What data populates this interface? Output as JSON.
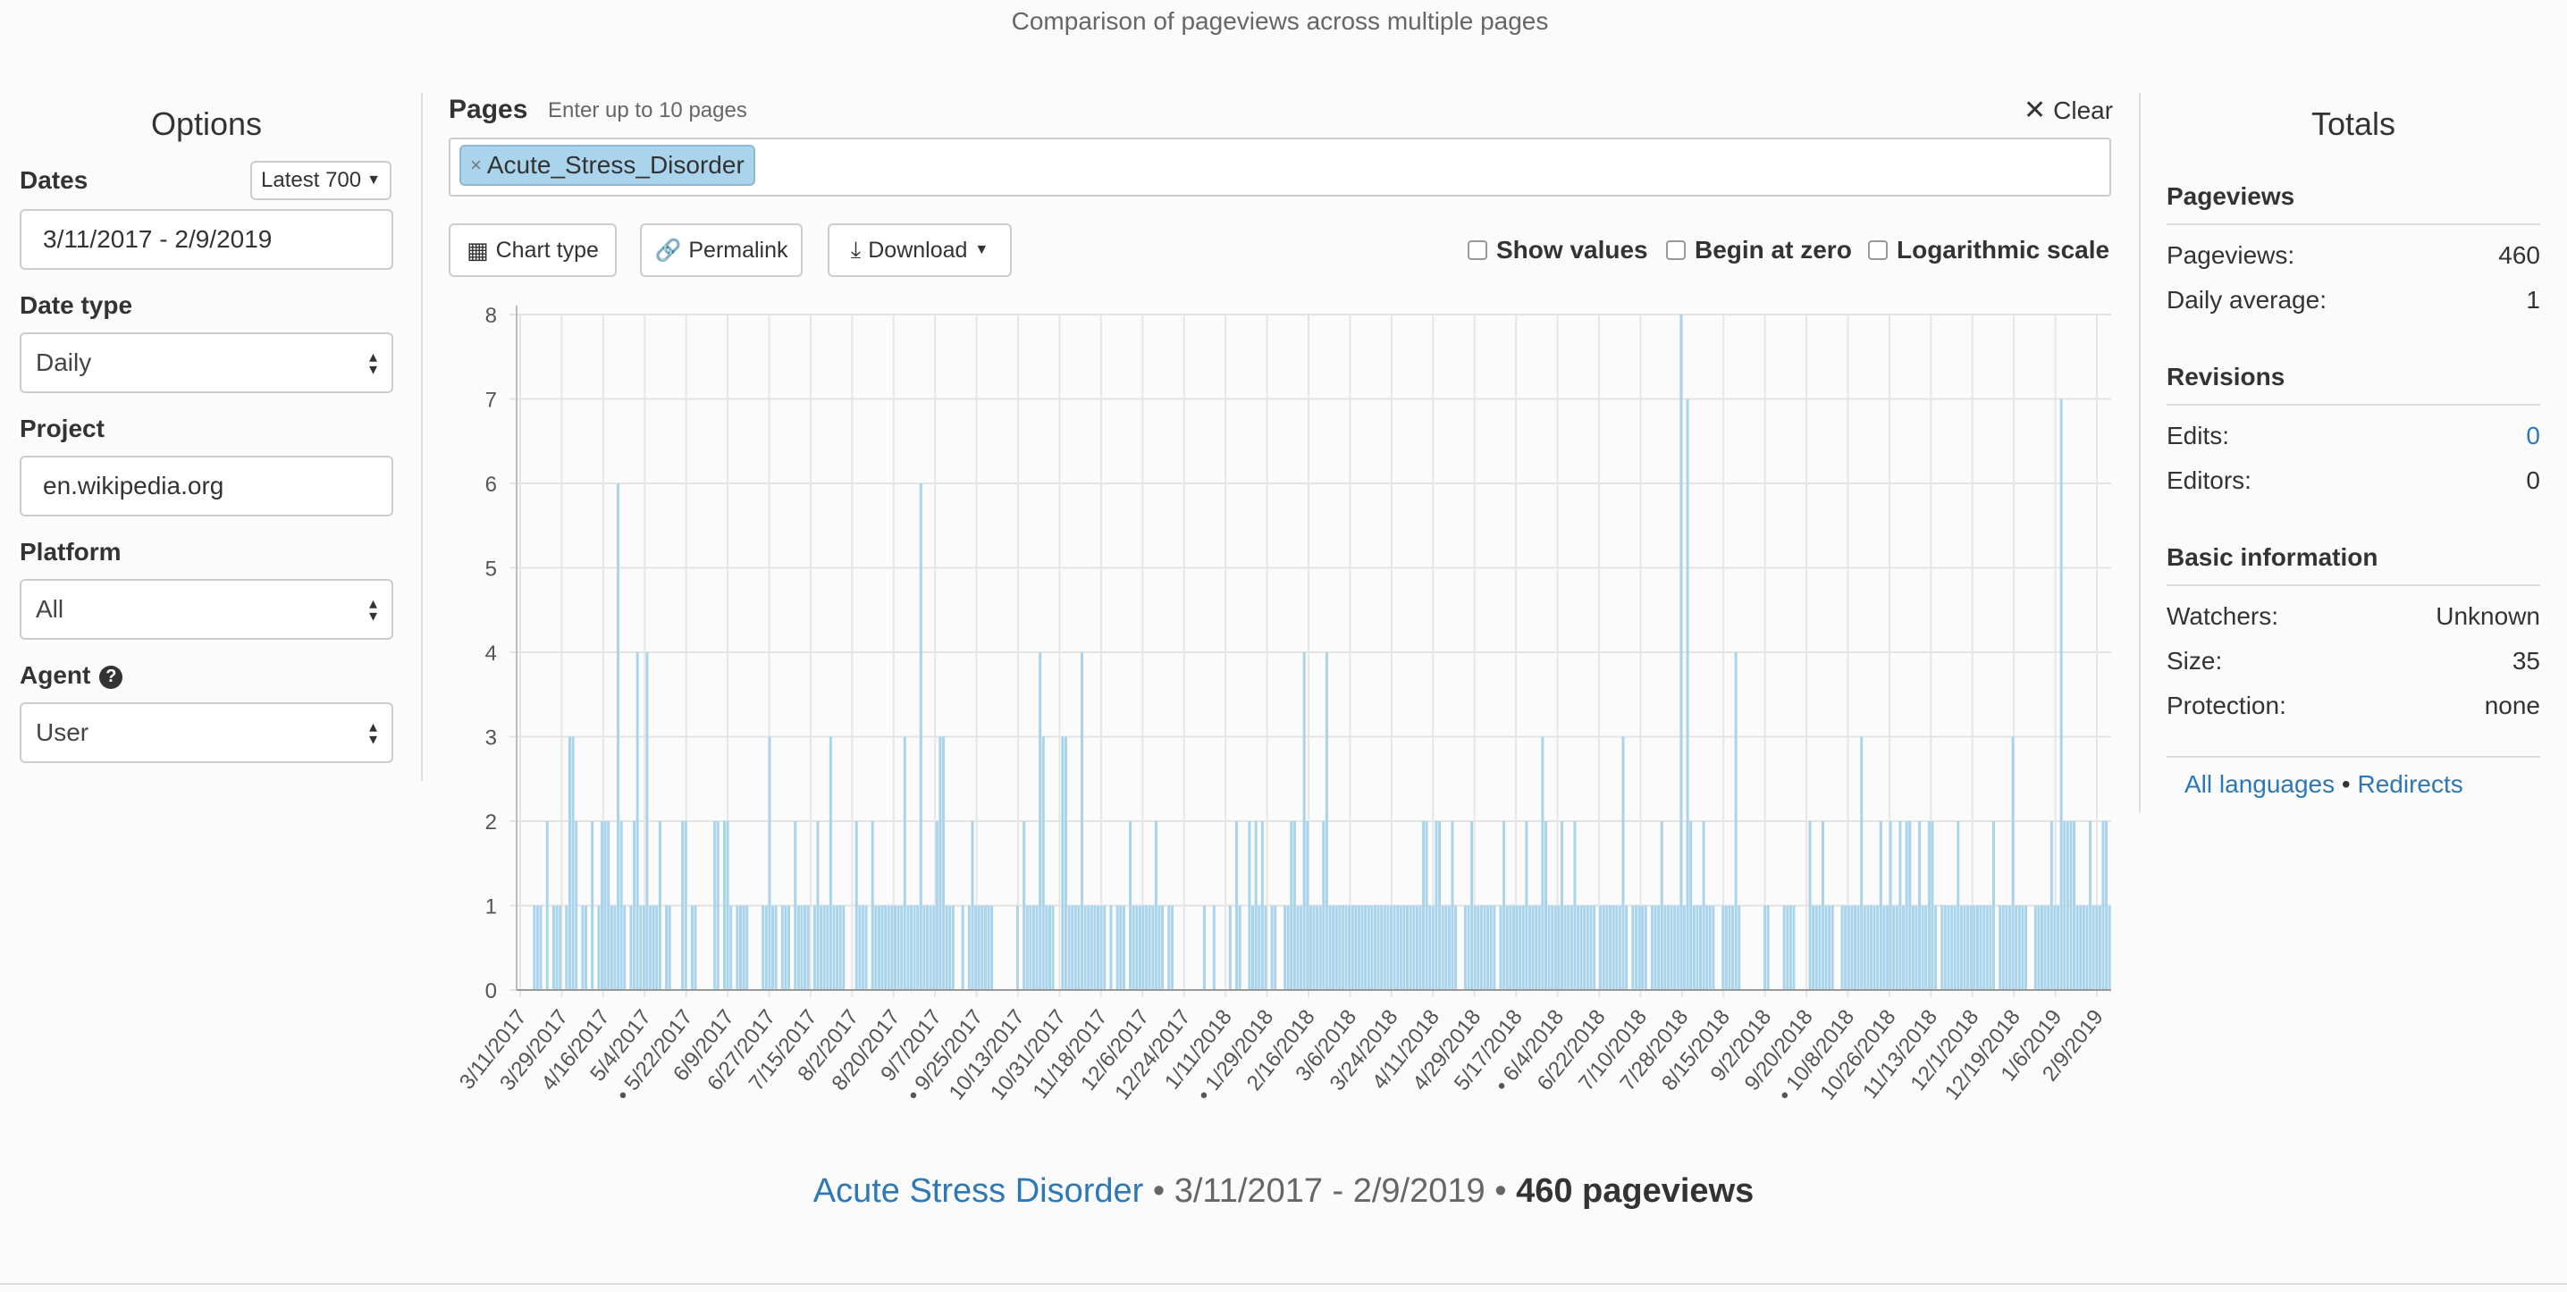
{
  "caption": "Comparison of pageviews across multiple pages",
  "options": {
    "title": "Options",
    "dates_label": "Dates",
    "latest_button": "Latest 700",
    "dates_value": "3/11/2017 - 2/9/2019",
    "date_type_label": "Date type",
    "date_type_value": "Daily",
    "project_label": "Project",
    "project_value": "en.wikipedia.org",
    "platform_label": "Platform",
    "platform_value": "All",
    "agent_label": "Agent",
    "agent_value": "User"
  },
  "pages": {
    "label": "Pages",
    "hint": "Enter up to 10 pages",
    "clear_label": "Clear",
    "tag": "Acute_Stress_Disorder"
  },
  "toolbar": {
    "chart_type": "Chart type",
    "permalink": "Permalink",
    "download": "Download",
    "show_values": "Show values",
    "begin_at_zero": "Begin at zero",
    "log_scale": "Logarithmic scale"
  },
  "chart_data": {
    "type": "bar",
    "title": "",
    "xlabel": "",
    "ylabel": "",
    "ylim": [
      0,
      8
    ],
    "yticks": [
      0,
      1,
      2,
      3,
      4,
      5,
      6,
      7,
      8
    ],
    "xtick_labels": [
      "3/11/2017",
      "3/29/2017",
      "4/16/2017",
      "5/4/2017",
      "• 5/22/2017",
      "6/9/2017",
      "6/27/2017",
      "7/15/2017",
      "8/2/2017",
      "8/20/2017",
      "9/7/2017",
      "• 9/25/2017",
      "10/13/2017",
      "10/31/2017",
      "11/18/2017",
      "12/6/2017",
      "12/24/2017",
      "1/11/2018",
      "• 1/29/2018",
      "2/16/2018",
      "3/6/2018",
      "3/24/2018",
      "4/11/2018",
      "4/29/2018",
      "5/17/2018",
      "• 6/4/2018",
      "6/22/2018",
      "7/10/2018",
      "7/28/2018",
      "8/15/2018",
      "9/2/2018",
      "9/20/2018",
      "• 10/8/2018",
      "10/26/2018",
      "11/13/2018",
      "12/1/2018",
      "12/19/2018",
      "1/6/2019",
      "2/9/2019"
    ],
    "series": [
      {
        "color": "#a9d4ec",
        "values": [
          0,
          0,
          0,
          0,
          0,
          1,
          1,
          1,
          0,
          2,
          0,
          1,
          1,
          1,
          0,
          1,
          3,
          3,
          2,
          0,
          1,
          1,
          0,
          2,
          0,
          1,
          2,
          2,
          2,
          1,
          1,
          6,
          2,
          1,
          0,
          1,
          2,
          4,
          1,
          1,
          4,
          1,
          1,
          1,
          2,
          0,
          1,
          1,
          0,
          0,
          0,
          2,
          2,
          0,
          1,
          1,
          0,
          0,
          0,
          0,
          0,
          2,
          2,
          0,
          2,
          2,
          1,
          0,
          1,
          1,
          1,
          1,
          0,
          0,
          0,
          0,
          1,
          1,
          3,
          1,
          1,
          0,
          1,
          1,
          1,
          0,
          2,
          1,
          1,
          1,
          1,
          0,
          1,
          2,
          1,
          1,
          1,
          3,
          1,
          1,
          1,
          1,
          0,
          0,
          0,
          2,
          1,
          1,
          1,
          0,
          2,
          1,
          1,
          1,
          1,
          1,
          1,
          1,
          1,
          1,
          3,
          1,
          1,
          1,
          1,
          6,
          1,
          1,
          1,
          1,
          2,
          3,
          3,
          1,
          1,
          1,
          0,
          0,
          1,
          0,
          1,
          2,
          1,
          1,
          1,
          1,
          1,
          1,
          0,
          0,
          0,
          0,
          0,
          0,
          0,
          1,
          0,
          2,
          1,
          1,
          1,
          1,
          4,
          3,
          1,
          1,
          1,
          0,
          0,
          3,
          3,
          1,
          1,
          1,
          1,
          4,
          1,
          1,
          1,
          1,
          1,
          1,
          1,
          0,
          1,
          0,
          1,
          1,
          1,
          0,
          2,
          1,
          1,
          1,
          1,
          1,
          1,
          1,
          2,
          1,
          1,
          0,
          1,
          1,
          0,
          0,
          0,
          0,
          0,
          0,
          0,
          0,
          0,
          1,
          0,
          0,
          1,
          0,
          0,
          0,
          0,
          1,
          0,
          2,
          1,
          0,
          0,
          2,
          1,
          2,
          1,
          2,
          1,
          0,
          1,
          1,
          0,
          0,
          1,
          1,
          2,
          2,
          1,
          1,
          4,
          2,
          1,
          1,
          1,
          1,
          2,
          4,
          1,
          1,
          1,
          1,
          1,
          1,
          1,
          1,
          1,
          1,
          1,
          1,
          1,
          1,
          1,
          1,
          1,
          1,
          1,
          1,
          1,
          1,
          1,
          1,
          1,
          1,
          1,
          1,
          1,
          2,
          2,
          1,
          1,
          2,
          2,
          1,
          1,
          1,
          2,
          1,
          0,
          0,
          1,
          1,
          2,
          1,
          1,
          1,
          1,
          1,
          1,
          1,
          0,
          1,
          2,
          1,
          1,
          1,
          1,
          1,
          1,
          2,
          1,
          1,
          1,
          1,
          3,
          2,
          1,
          1,
          1,
          1,
          2,
          1,
          1,
          1,
          2,
          1,
          1,
          1,
          1,
          1,
          1,
          0,
          1,
          1,
          1,
          1,
          1,
          1,
          1,
          3,
          1,
          0,
          1,
          1,
          1,
          1,
          1,
          0,
          1,
          1,
          1,
          2,
          1,
          1,
          1,
          1,
          1,
          8,
          1,
          7,
          2,
          1,
          1,
          1,
          2,
          1,
          1,
          1,
          0,
          0,
          1,
          1,
          1,
          1,
          4,
          1,
          0,
          0,
          0,
          0,
          0,
          0,
          0,
          1,
          1,
          0,
          0,
          0,
          0,
          1,
          1,
          1,
          1,
          0,
          0,
          0,
          0,
          2,
          1,
          1,
          1,
          2,
          1,
          1,
          1,
          0,
          0,
          1,
          1,
          1,
          1,
          1,
          1,
          3,
          1,
          1,
          1,
          1,
          1,
          2,
          1,
          1,
          2,
          1,
          1,
          2,
          1,
          2,
          2,
          1,
          1,
          2,
          1,
          1,
          2,
          2,
          1,
          0,
          1,
          1,
          1,
          1,
          1,
          2,
          1,
          1,
          1,
          1,
          1,
          1,
          1,
          1,
          1,
          1,
          2,
          0,
          1,
          1,
          1,
          1,
          3,
          1,
          1,
          1,
          1,
          0,
          0,
          1,
          1,
          1,
          1,
          1,
          2,
          1,
          1,
          7,
          2,
          2,
          2,
          2,
          1,
          1,
          1,
          1,
          2,
          1,
          1,
          1,
          2,
          2,
          1
        ]
      }
    ]
  },
  "summary": {
    "title": "Acute Stress Disorder",
    "range": "3/11/2017 - 2/9/2019",
    "sep": "•",
    "pageviews": "460 pageviews"
  },
  "totals": {
    "title": "Totals",
    "pageviews_head": "Pageviews",
    "pageviews_label": "Pageviews:",
    "pageviews_value": "460",
    "daily_avg_label": "Daily average:",
    "daily_avg_value": "1",
    "revisions_head": "Revisions",
    "edits_label": "Edits:",
    "edits_value": "0",
    "editors_label": "Editors:",
    "editors_value": "0",
    "basic_head": "Basic information",
    "watchers_label": "Watchers:",
    "watchers_value": "Unknown",
    "size_label": "Size:",
    "size_value": "35",
    "protection_label": "Protection:",
    "protection_value": "none",
    "all_languages": "All languages",
    "links_sep": "•",
    "redirects": "Redirects"
  }
}
